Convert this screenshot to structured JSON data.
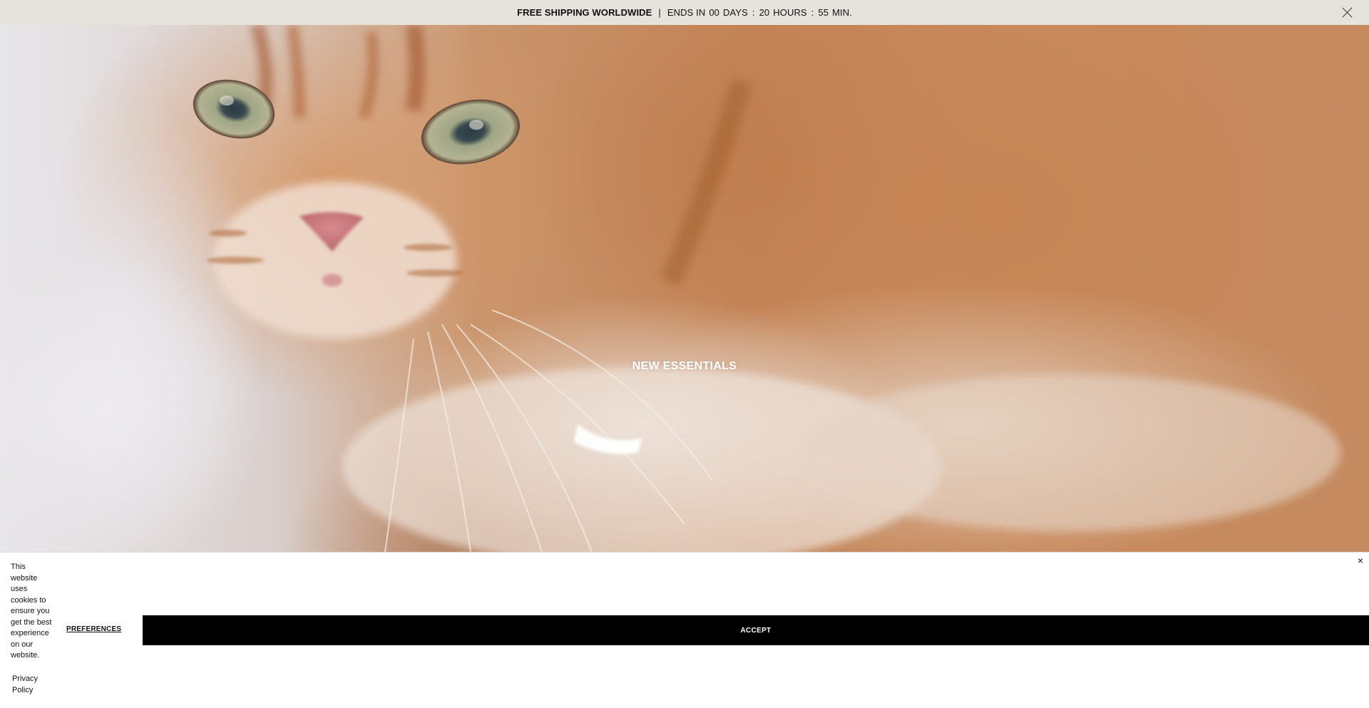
{
  "announcement": {
    "headline": "FREE SHIPPING WORLDWIDE",
    "separator": "|",
    "ends_label": "ENDS IN",
    "days_value": "00",
    "days_label": "DAYS",
    "hours_value": "20",
    "hours_label": "HOURS",
    "minutes_value": "55",
    "minutes_label": "MIN.",
    "colon": ":",
    "close_icon": "close-icon"
  },
  "hero": {
    "title": "NEW ESSENTIALS"
  },
  "cookie_banner": {
    "message": "This website uses cookies to ensure you get the best experience on our website.",
    "privacy_link": "Privacy Policy",
    "preferences_label": "PREFERENCES",
    "accept_label": "ACCEPT",
    "close_glyph": "×",
    "close_icon": "close-icon"
  },
  "colors": {
    "announcement_bg": "#e6e2dc",
    "accept_bg": "#000000",
    "accept_text": "#ffffff"
  }
}
